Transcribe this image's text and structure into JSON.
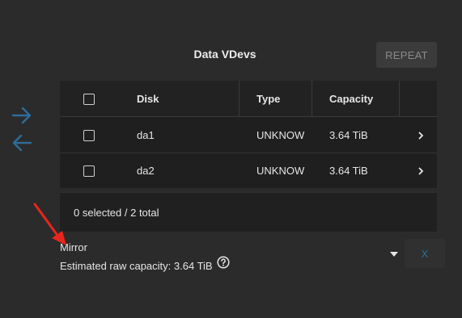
{
  "dialog": {
    "title": "Data VDevs",
    "repeat_label": "REPEAT"
  },
  "table": {
    "headers": [
      "Disk",
      "Type",
      "Capacity"
    ],
    "rows": [
      {
        "disk": "da1",
        "type": "UNKNOW",
        "capacity": "3.64 TiB"
      },
      {
        "disk": "da2",
        "type": "UNKNOW",
        "capacity": "3.64 TiB"
      }
    ],
    "footer": "0 selected / 2 total"
  },
  "layout": {
    "selected": "Mirror"
  },
  "capacity": {
    "label": "Estimated raw capacity: 3.64 TiB"
  },
  "close_label": "X",
  "colors": {
    "background": "#2b2b2b",
    "table_bg": "#1f1f1f",
    "arrow_blue": "#2e6d99",
    "annotation_red": "#e8261c"
  },
  "icons": {
    "move_right": "arrow-right-icon",
    "move_left": "arrow-left-icon",
    "row_expand": "chevron-right-icon",
    "dropdown": "caret-down-icon",
    "help": "help-circle-icon"
  }
}
